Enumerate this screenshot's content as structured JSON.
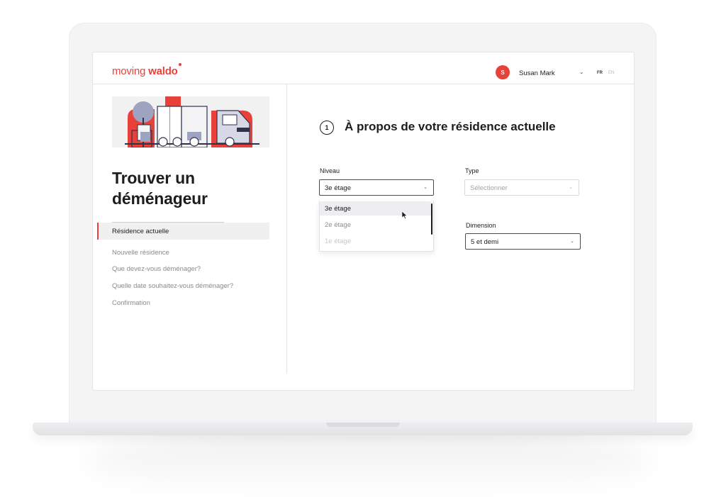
{
  "header": {
    "logo_part1": "moving ",
    "logo_part2": "waldo",
    "avatar_initial": "S",
    "user_name": "Susan Mark",
    "lang_fr": "FR",
    "lang_en": "EN"
  },
  "sidebar": {
    "title": "Trouver un déménageur",
    "steps": [
      {
        "label": "Résidence actuelle",
        "active": true
      },
      {
        "label": "Nouvelle résidence",
        "active": false
      },
      {
        "label": "Que devez-vous déménager?",
        "active": false
      },
      {
        "label": "Quelle date souhaitez-vous déménager?",
        "active": false
      },
      {
        "label": "Confirmation",
        "active": false
      }
    ]
  },
  "main": {
    "step_number": "1",
    "section_title": "À propos de votre résidence actuelle",
    "fields": {
      "niveau": {
        "label": "Niveau",
        "value": "3e étage"
      },
      "type": {
        "label": "Type",
        "placeholder": "Sélectionner"
      },
      "dimension": {
        "label": "Dimension",
        "value": "5 et demi"
      }
    },
    "niveau_options": [
      "3e étage",
      "2e étage",
      "1e étage"
    ]
  },
  "colors": {
    "brand_red": "#e8413a",
    "text_dark": "#1d1d1f",
    "text_muted": "#8a8a8f"
  },
  "icons": [
    "chevron-down-icon",
    "mouse-cursor-icon",
    "truck-illustration"
  ]
}
